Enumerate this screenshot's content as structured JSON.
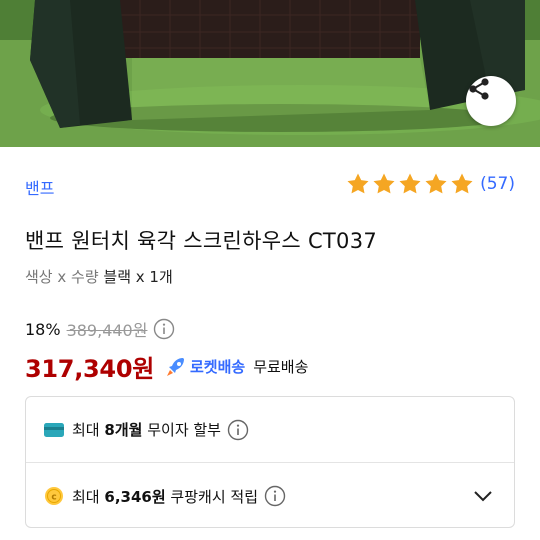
{
  "hero": {
    "alt": "green screen house tent on grass"
  },
  "icons": {
    "share": "share-icon",
    "info": "info-icon",
    "rocket": "rocket-icon",
    "card": "card-icon",
    "coin": "coin-icon",
    "chevron": "chevron-down-icon",
    "star": "star-icon"
  },
  "brand": {
    "label": "밴프"
  },
  "rating": {
    "stars": 5,
    "count_text": "(57)"
  },
  "product": {
    "title": "밴프 원터치 육각 스크린하우스 CT037"
  },
  "option": {
    "key": "색상 x 수량",
    "value": "블랙 x 1개"
  },
  "price": {
    "discount": "18%",
    "original": "389,440원",
    "sale": "317,340원",
    "rocket_label": "로켓배송",
    "shipping": "무료배송"
  },
  "benefits": {
    "installment": {
      "prefix": "최대",
      "months": "8개월",
      "suffix": "무이자 할부"
    },
    "cashback": {
      "prefix": "최대",
      "amount": "6,346원",
      "suffix": "쿠팡캐시 적립"
    }
  },
  "colors": {
    "accent_blue": "#346aff",
    "price_red": "#ae0000",
    "star_orange": "#f5a623"
  }
}
